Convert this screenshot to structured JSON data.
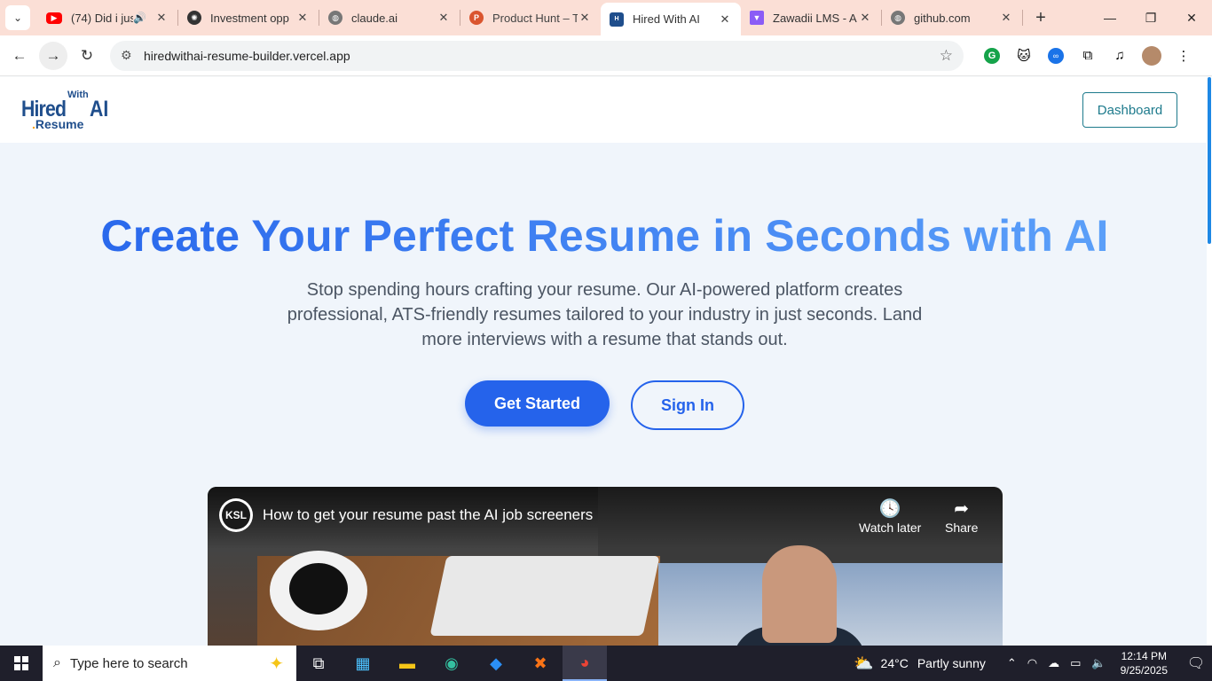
{
  "browser": {
    "tabs": [
      {
        "title": "(74) Did i jus",
        "favicon_color": "#ff0000",
        "favicon": "youtube-icon",
        "audio": true
      },
      {
        "title": "Investment opp",
        "favicon_color": "#333333",
        "favicon": "openai-icon"
      },
      {
        "title": "claude.ai",
        "favicon_color": "#777777",
        "favicon": "globe-icon"
      },
      {
        "title": "Product Hunt – T",
        "favicon_color": "#da552f",
        "favicon": "producthunt-icon",
        "favicon_letter": "P"
      },
      {
        "title": "Hired With AI",
        "favicon_color": "#1f4e8c",
        "favicon": "hiredwithai-icon",
        "active": true
      },
      {
        "title": "Zawadii LMS - A",
        "favicon_color": "#8b5cf6",
        "favicon": "vite-icon"
      },
      {
        "title": "github.com",
        "favicon_color": "#777777",
        "favicon": "globe-icon"
      }
    ],
    "url": "hiredwithai-resume-builder.vercel.app"
  },
  "site": {
    "logo": {
      "hired": "Hired",
      "with": "With",
      "ai": "AI",
      "resume": "Resume"
    },
    "dashboard_label": "Dashboard",
    "hero": {
      "title": "Create Your Perfect Resume in Seconds with AI",
      "subtitle": "Stop spending hours crafting your resume. Our AI-powered platform creates professional, ATS-friendly resumes tailored to your industry in just seconds. Land more interviews with a resume that stands out.",
      "primary_cta": "Get Started",
      "secondary_cta": "Sign In"
    },
    "video": {
      "channel": "KSL",
      "title": "How to get your resume past the AI job screeners",
      "watch_later": "Watch later",
      "share": "Share"
    }
  },
  "taskbar": {
    "search_placeholder": "Type here to search",
    "weather": {
      "temp": "24°C",
      "condition": "Partly sunny"
    },
    "time": "12:14 PM",
    "date": "9/25/2025"
  }
}
